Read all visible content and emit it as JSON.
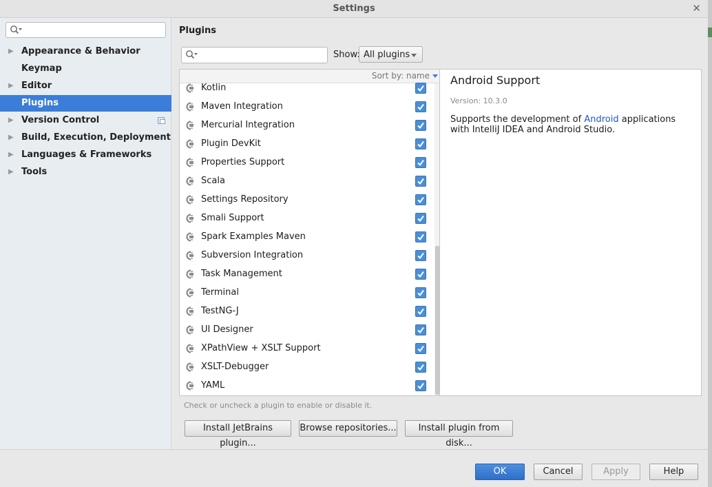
{
  "window": {
    "title": "Settings"
  },
  "sidebar": {
    "search_placeholder": "",
    "items": [
      {
        "label": "Appearance & Behavior",
        "expandable": true,
        "selected": false
      },
      {
        "label": "Keymap",
        "expandable": false,
        "selected": false
      },
      {
        "label": "Editor",
        "expandable": true,
        "selected": false
      },
      {
        "label": "Plugins",
        "expandable": false,
        "selected": true
      },
      {
        "label": "Version Control",
        "expandable": true,
        "selected": false
      },
      {
        "label": "Build, Execution, Deployment",
        "expandable": true,
        "selected": false
      },
      {
        "label": "Languages & Frameworks",
        "expandable": true,
        "selected": false
      },
      {
        "label": "Tools",
        "expandable": true,
        "selected": false
      }
    ]
  },
  "plugins": {
    "title": "Plugins",
    "search_placeholder": "",
    "show_label": "Show:",
    "show_value": "All plugins",
    "sort_label": "Sort by: name",
    "list": [
      {
        "name": "Kotlin",
        "enabled": true
      },
      {
        "name": "Maven Integration",
        "enabled": true
      },
      {
        "name": "Mercurial Integration",
        "enabled": true
      },
      {
        "name": "Plugin DevKit",
        "enabled": true
      },
      {
        "name": "Properties Support",
        "enabled": true
      },
      {
        "name": "Scala",
        "enabled": true
      },
      {
        "name": "Settings Repository",
        "enabled": true
      },
      {
        "name": "Smali Support",
        "enabled": true
      },
      {
        "name": "Spark Examples Maven",
        "enabled": true
      },
      {
        "name": "Subversion Integration",
        "enabled": true
      },
      {
        "name": "Task Management",
        "enabled": true
      },
      {
        "name": "Terminal",
        "enabled": true
      },
      {
        "name": "TestNG-J",
        "enabled": true
      },
      {
        "name": "UI Designer",
        "enabled": true
      },
      {
        "name": "XPathView + XSLT Support",
        "enabled": true
      },
      {
        "name": "XSLT-Debugger",
        "enabled": true
      },
      {
        "name": "YAML",
        "enabled": true
      }
    ],
    "detail": {
      "name": "Android Support",
      "version": "Version: 10.3.0",
      "desc_prefix": "Supports the development of ",
      "desc_link": "Android",
      "desc_suffix": " applications with IntelliJ IDEA and Android Studio."
    },
    "hint": "Check or uncheck a plugin to enable or disable it.",
    "install_jetbrains": "Install JetBrains plugin...",
    "browse_repos": "Browse repositories...",
    "install_disk": "Install plugin from disk..."
  },
  "footer": {
    "ok": "OK",
    "cancel": "Cancel",
    "apply": "Apply",
    "help": "Help"
  },
  "colors": {
    "selection": "#3b7dd8",
    "checkbox": "#4a8fd8",
    "link": "#2255cc"
  }
}
